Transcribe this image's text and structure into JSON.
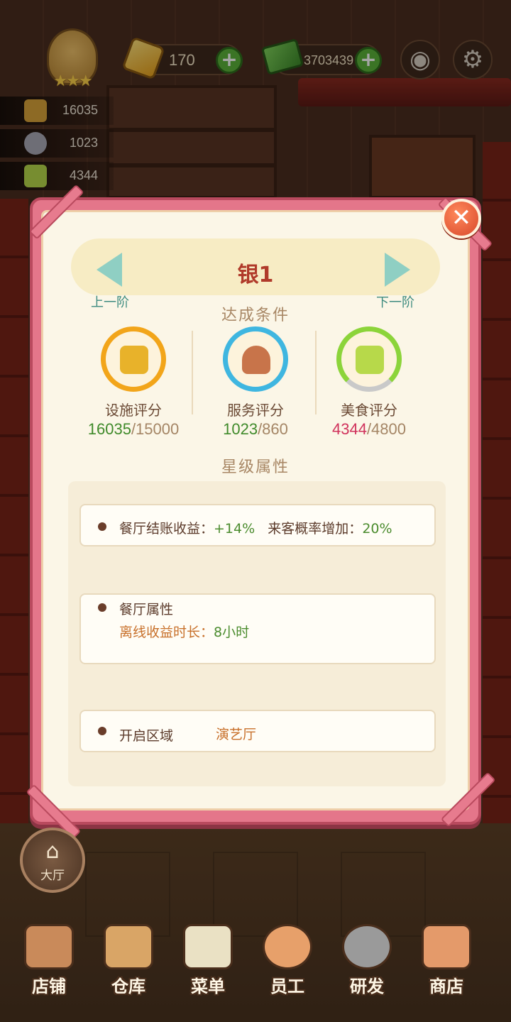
{
  "hud": {
    "gems": "170",
    "cash": "3703439",
    "rank_stars": "★★★",
    "camera_icon": "camera-icon",
    "settings_icon": "gear-icon"
  },
  "scores": {
    "facility": "16035",
    "service": "1023",
    "food": "4344"
  },
  "dialog": {
    "title": "银1",
    "prev_label": "上一阶",
    "next_label": "下一阶",
    "criteria_heading": "达成条件",
    "criteria": [
      {
        "label": "设施评分",
        "current": "16035",
        "target": "/15000",
        "met": true,
        "ring_color": "#f2a51a",
        "icon": "pot-icon"
      },
      {
        "label": "服务评分",
        "current": "1023",
        "target": "/860",
        "met": true,
        "ring_color": "#3fb6e0",
        "icon": "cloche-icon"
      },
      {
        "label": "美食评分",
        "current": "4344",
        "target": "/4800",
        "met": false,
        "ring_color": "#8cd43a",
        "icon": "recipe-book-icon"
      }
    ],
    "attributes_heading": "星级属性",
    "attr1": {
      "label": "餐厅结账收益：",
      "value1": "+14%",
      "label2": "来客概率增加：",
      "value2": "20%"
    },
    "attr2": {
      "label": "餐厅属性",
      "sub_label": "离线收益时长：",
      "sub_value": "8小时"
    },
    "attr3": {
      "label": "开启区域",
      "value": "演艺厅"
    },
    "close_icon": "close-icon"
  },
  "nav": {
    "hall": "大厅",
    "items": [
      "店铺",
      "仓库",
      "菜单",
      "员工",
      "研发",
      "商店"
    ]
  }
}
